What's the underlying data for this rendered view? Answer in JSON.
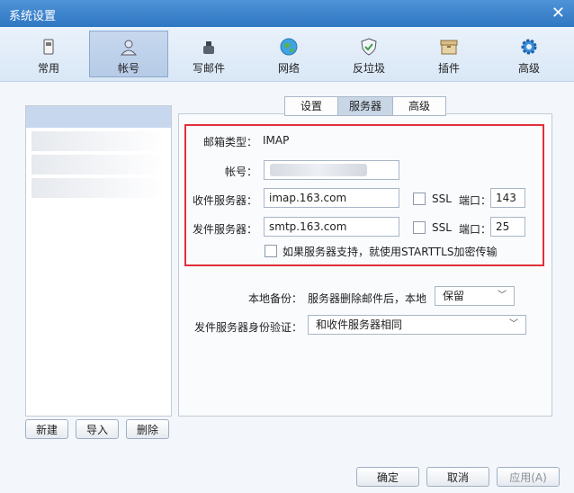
{
  "window": {
    "title": "系统设置",
    "close_glyph": "✕"
  },
  "toolbar": {
    "items": [
      {
        "label": "常用",
        "icon": "phone-icon"
      },
      {
        "label": "帐号",
        "icon": "user-icon"
      },
      {
        "label": "写邮件",
        "icon": "inkwell-icon"
      },
      {
        "label": "网络",
        "icon": "globe-icon"
      },
      {
        "label": "反垃圾",
        "icon": "shield-check-icon"
      },
      {
        "label": "插件",
        "icon": "box-icon"
      },
      {
        "label": "高级",
        "icon": "gear-icon"
      }
    ],
    "active_index": 1
  },
  "accounts": {
    "buttons": {
      "new": "新建",
      "import": "导入",
      "delete": "删除"
    }
  },
  "tabs": {
    "items": [
      "设置",
      "服务器",
      "高级"
    ],
    "active_index": 1
  },
  "server": {
    "mailbox_type_label": "邮箱类型：",
    "mailbox_type_value": "IMAP",
    "account_label": "帐号：",
    "incoming_label": "收件服务器：",
    "incoming_value": "imap.163.com",
    "outgoing_label": "发件服务器：",
    "outgoing_value": "smtp.163.com",
    "ssl_label": "SSL",
    "port_label": "端口：",
    "incoming_port": "143",
    "outgoing_port": "25",
    "starttls_label": "如果服务器支持，就使用STARTTLS加密传输"
  },
  "backup": {
    "label": "本地备份：",
    "description": "服务器删除邮件后，本地",
    "value": "保留"
  },
  "auth": {
    "label": "发件服务器身份验证：",
    "value": "和收件服务器相同"
  },
  "footer": {
    "ok": "确定",
    "cancel": "取消",
    "apply": "应用(A)"
  },
  "colors": {
    "highlight_border": "#e0303a",
    "titlebar": "#2f77c3"
  }
}
